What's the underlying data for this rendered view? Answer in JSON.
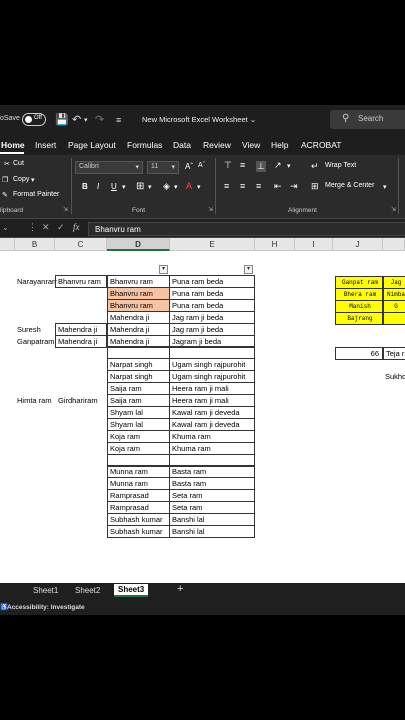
{
  "titlebar": {
    "autosave_label": "oSave",
    "toggle_label": "Off",
    "doc_title": "New Microsoft Excel Worksheet",
    "search_placeholder": "Search"
  },
  "menu": {
    "tabs": [
      "Home",
      "Insert",
      "Page Layout",
      "Formulas",
      "Data",
      "Review",
      "View",
      "Help",
      "ACROBAT"
    ]
  },
  "ribbon": {
    "cut": "Cut",
    "copy": "Copy",
    "format_painter": "Format Painter",
    "clipboard_label": "lipboard",
    "font_name": "Calibri",
    "font_size": "11",
    "font_label": "Font",
    "wrap_text": "Wrap Text",
    "merge_center": "Merge & Center",
    "alignment_label": "Alignment",
    "bold": "B",
    "italic": "I",
    "underline": "U"
  },
  "formula_bar": {
    "fx": "fx",
    "value": "Bhanvru ram"
  },
  "columns": [
    "B",
    "C",
    "D",
    "E",
    "H",
    "I",
    "J"
  ],
  "cells": {
    "b_narayanram": "Narayanram",
    "c_bhanvru": "Bhanvru ram",
    "b_suresh": "Suresh",
    "c_mahendra1": "Mahendra ji",
    "b_ganpatram": "Ganpatram",
    "c_mahendra2": "Mahendra ji",
    "b_himta": "Himta ram",
    "c_girdhari": "Girdhariram",
    "d_rows": [
      "Bhanvru ram",
      "Bhanvru ram",
      "Bhanvru ram",
      "Mahendra ji",
      "Mahendra ji",
      "Mahendra ji",
      "",
      "Narpat singh",
      "Narpat singh",
      "Saija ram",
      "Saija ram",
      "Shyam lal",
      "Shyam lal",
      "Koja ram",
      "Koja ram",
      "",
      "Munna ram",
      "Munna ram",
      "Ramprasad",
      "Ramprasad",
      "Subhash kumar",
      "Subhash kumar"
    ],
    "e_rows": [
      "Puna ram beda",
      "Puna ram beda",
      "Puna ram beda",
      "Jag ram ji beda",
      "Jag ram ji beda",
      "Jagram ji beda",
      "",
      "Ugam singh rajpurohit",
      "Ugam singh rajpurohit",
      "Heera ram ji mali",
      "Heera ram ji mali",
      "Kawal ram ji deveda",
      "Kawal ram ji deveda",
      "Khuma ram",
      "Khuma ram",
      "",
      "Basta ram",
      "Basta ram",
      "Seta ram",
      "Seta ram",
      "Banshi lal",
      "Banshi lal"
    ],
    "j_yellow": [
      "Ganpat ram",
      "Bhera ram",
      "Manish",
      "Bajrang"
    ],
    "k_yellow": [
      "Jag",
      "Nimba",
      "G",
      ""
    ],
    "j_num": "66",
    "k_teja": "Teja r",
    "k_sukh": "Sukhd"
  },
  "sheets": [
    "Sheet1",
    "Sheet2",
    "Sheet3"
  ],
  "active_sheet": "Sheet3",
  "status": {
    "accessibility": "Accessibility: Investigate"
  },
  "colors": {
    "highlight": "#f6c4a4",
    "yellow": "#ffff00",
    "excel_green": "#217346"
  }
}
